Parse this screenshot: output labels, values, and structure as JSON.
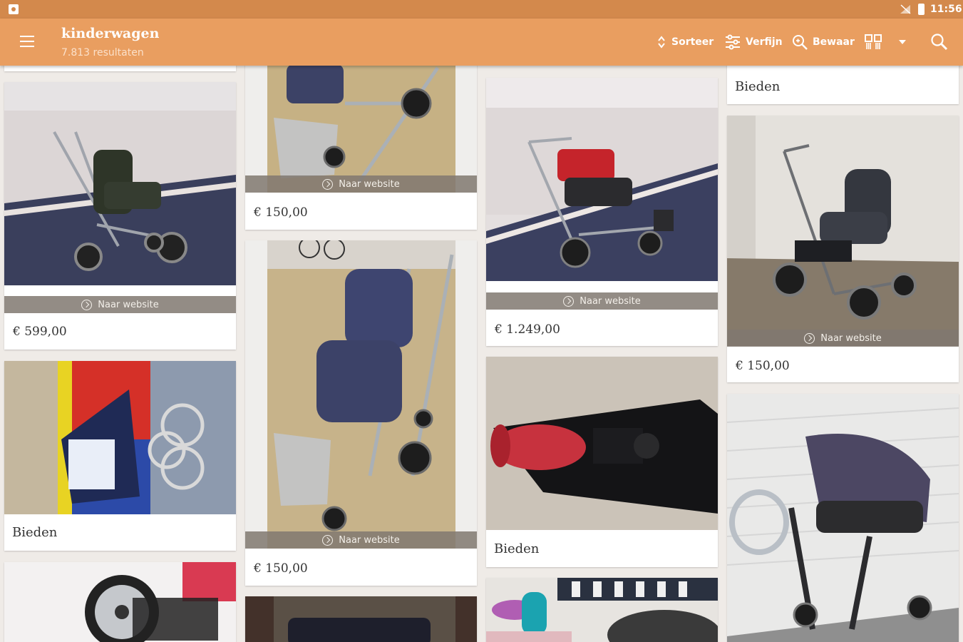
{
  "status_bar": {
    "time": "11:56",
    "icons": [
      "notification-icon",
      "signal-icon",
      "battery-icon"
    ]
  },
  "app_bar": {
    "title": "kinderwagen",
    "subtitle": "7.813 resultaten",
    "actions": {
      "sort": "Sorteer",
      "filter": "Verfijn",
      "save": "Bewaar"
    },
    "icons": [
      "menu-icon",
      "sort-icon",
      "filter-icon",
      "save-search-icon",
      "compare-icon",
      "dropdown-icon",
      "search-icon"
    ]
  },
  "colors": {
    "status_bar": "#d3894c",
    "app_bar": "#e99e60",
    "background": "#efebe7",
    "website_bar": "#807870"
  },
  "listings": [
    {
      "price": "€ 599,00",
      "link": "Naar website"
    },
    {
      "price": "Bieden"
    },
    {
      "price": "€ 150,00",
      "link": "Naar website"
    },
    {
      "price": "€ 150,00",
      "link": "Naar website"
    },
    {
      "price": "€ 1.249,00",
      "link": "Naar website"
    },
    {
      "price": "Bieden"
    },
    {
      "price": "Bieden"
    },
    {
      "price": "€ 150,00",
      "link": "Naar website"
    }
  ]
}
